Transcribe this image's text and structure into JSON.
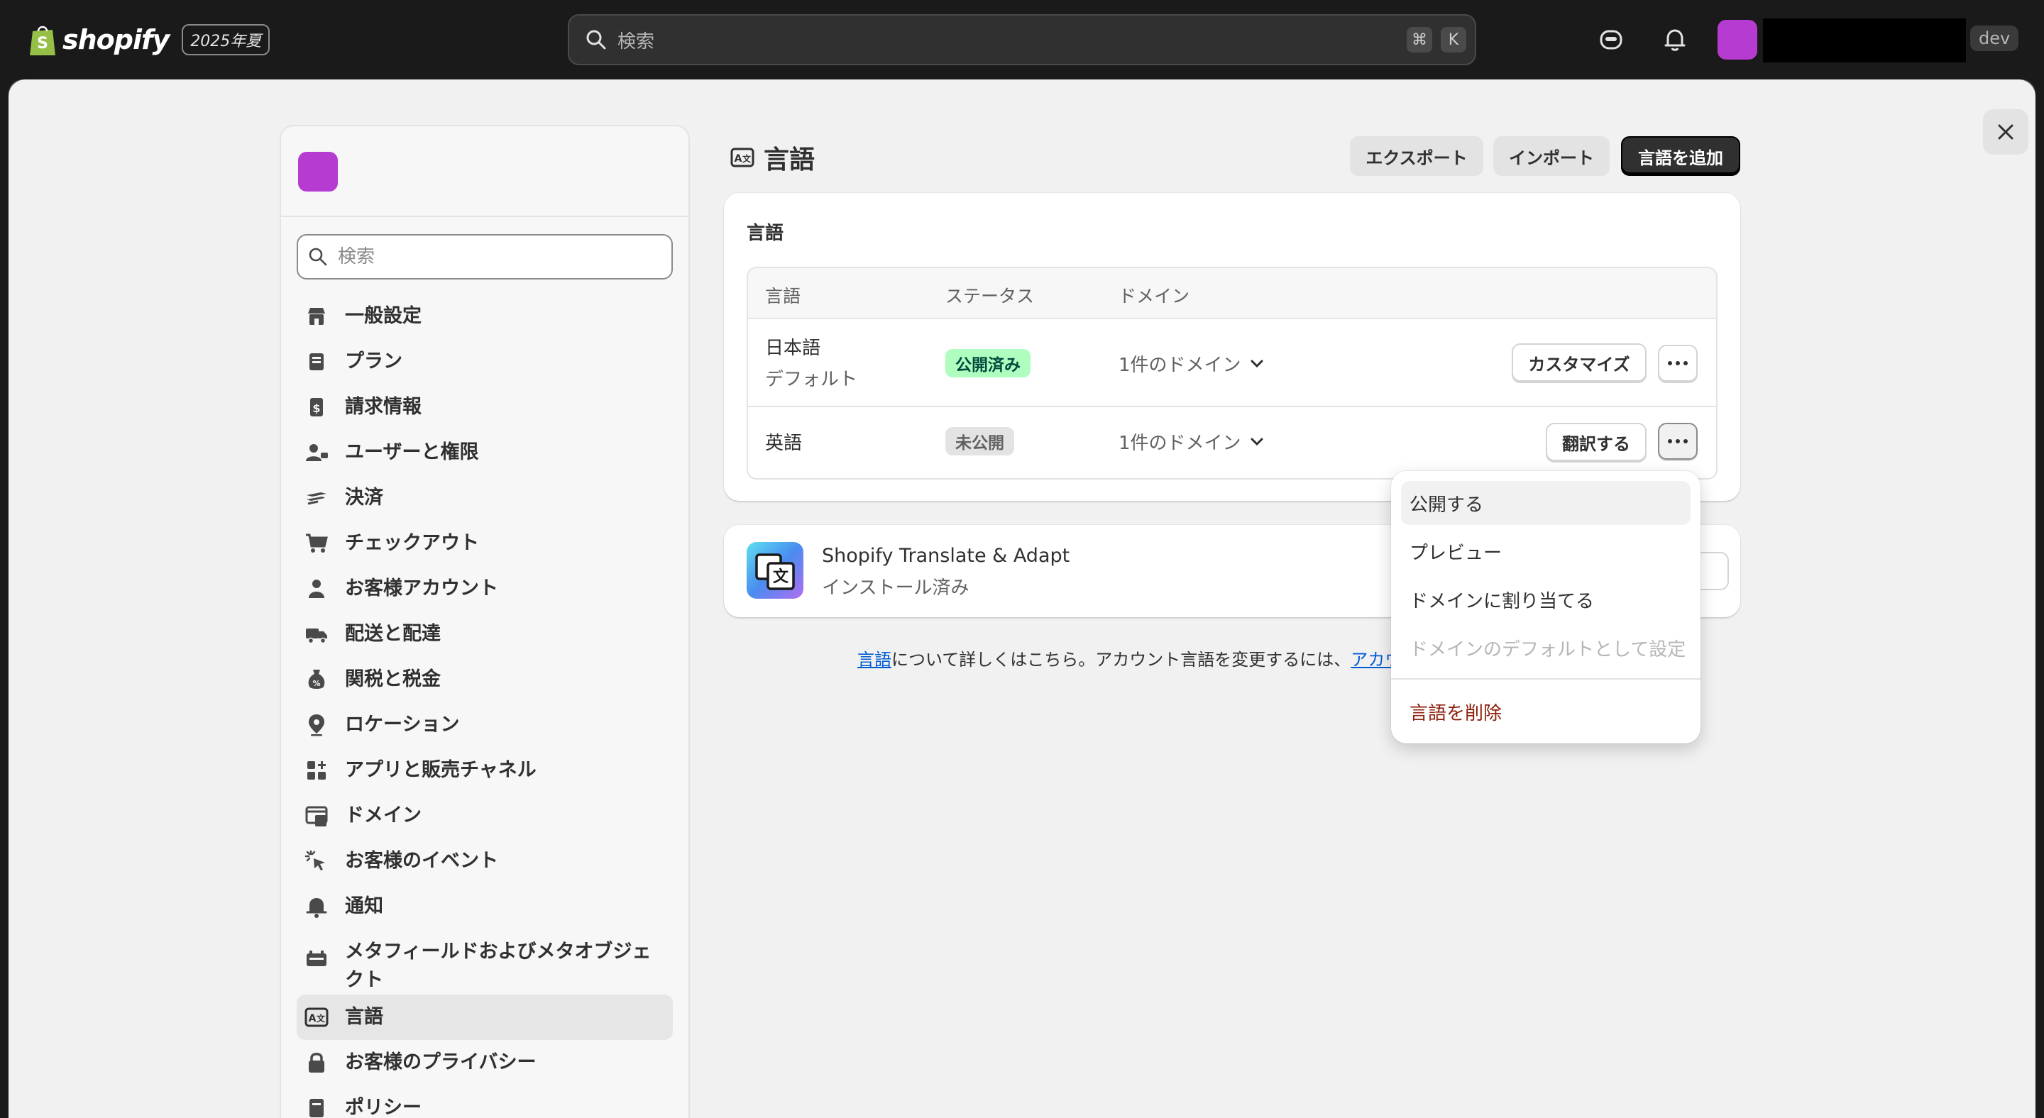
{
  "topbar": {
    "brand": "shopify",
    "edition": "2025年夏",
    "search_placeholder": "検索",
    "shortcut_cmd": "⌘",
    "shortcut_key": "K",
    "user_tag": "dev",
    "icons": [
      "sidekick-icon",
      "bell-icon"
    ]
  },
  "sidebar": {
    "search_placeholder": "検索",
    "items": [
      {
        "label": "一般設定",
        "icon": "store-icon"
      },
      {
        "label": "プラン",
        "icon": "plan-icon"
      },
      {
        "label": "請求情報",
        "icon": "billing-icon"
      },
      {
        "label": "ユーザーと権限",
        "icon": "users-icon"
      },
      {
        "label": "決済",
        "icon": "payments-icon"
      },
      {
        "label": "チェックアウト",
        "icon": "cart-icon"
      },
      {
        "label": "お客様アカウント",
        "icon": "person-icon"
      },
      {
        "label": "配送と配達",
        "icon": "truck-icon"
      },
      {
        "label": "関税と税金",
        "icon": "tax-icon"
      },
      {
        "label": "ロケーション",
        "icon": "location-icon"
      },
      {
        "label": "アプリと販売チャネル",
        "icon": "apps-icon"
      },
      {
        "label": "ドメイン",
        "icon": "domain-icon"
      },
      {
        "label": "お客様のイベント",
        "icon": "events-icon"
      },
      {
        "label": "通知",
        "icon": "notification-icon"
      },
      {
        "label": "メタフィールドおよびメタオブジェクト",
        "icon": "metafields-icon"
      },
      {
        "label": "言語",
        "icon": "language-icon",
        "active": true
      },
      {
        "label": "お客様のプライバシー",
        "icon": "lock-icon"
      },
      {
        "label": "ポリシー",
        "icon": "policy-icon"
      }
    ]
  },
  "main": {
    "title": "言語",
    "buttons": {
      "export": "エクスポート",
      "import": "インポート",
      "add": "言語を追加"
    },
    "languages_card": {
      "title": "言語",
      "columns": [
        "言語",
        "ステータス",
        "ドメイン"
      ],
      "rows": [
        {
          "name": "日本語",
          "sub": "デフォルト",
          "status": "公開済み",
          "status_color": "#affebf",
          "domain": "1件のドメイン",
          "action": "カスタマイズ"
        },
        {
          "name": "英語",
          "sub": "",
          "status": "未公開",
          "status_color": "#e3e3e3",
          "domain": "1件のドメイン",
          "action": "翻訳する"
        }
      ]
    },
    "app_card": {
      "name": "Shopify Translate & Adapt",
      "status": "インストール済み"
    },
    "footer": {
      "link1": "言語",
      "text": "について詳しくはこちら。アカウント言語を変更するには、",
      "link2": "アカウ"
    }
  },
  "menu": {
    "items": [
      {
        "label": "公開する",
        "state": "hover"
      },
      {
        "label": "プレビュー",
        "state": "normal"
      },
      {
        "label": "ドメインに割り当てる",
        "state": "normal"
      },
      {
        "label": "ドメインのデフォルトとして設定",
        "state": "disabled"
      },
      {
        "label": "言語を削除",
        "state": "danger"
      }
    ]
  },
  "colors": {
    "accent": "#b63bd1",
    "primary_button": "#303030",
    "link": "#005bd3",
    "danger": "#8e1f0b"
  }
}
